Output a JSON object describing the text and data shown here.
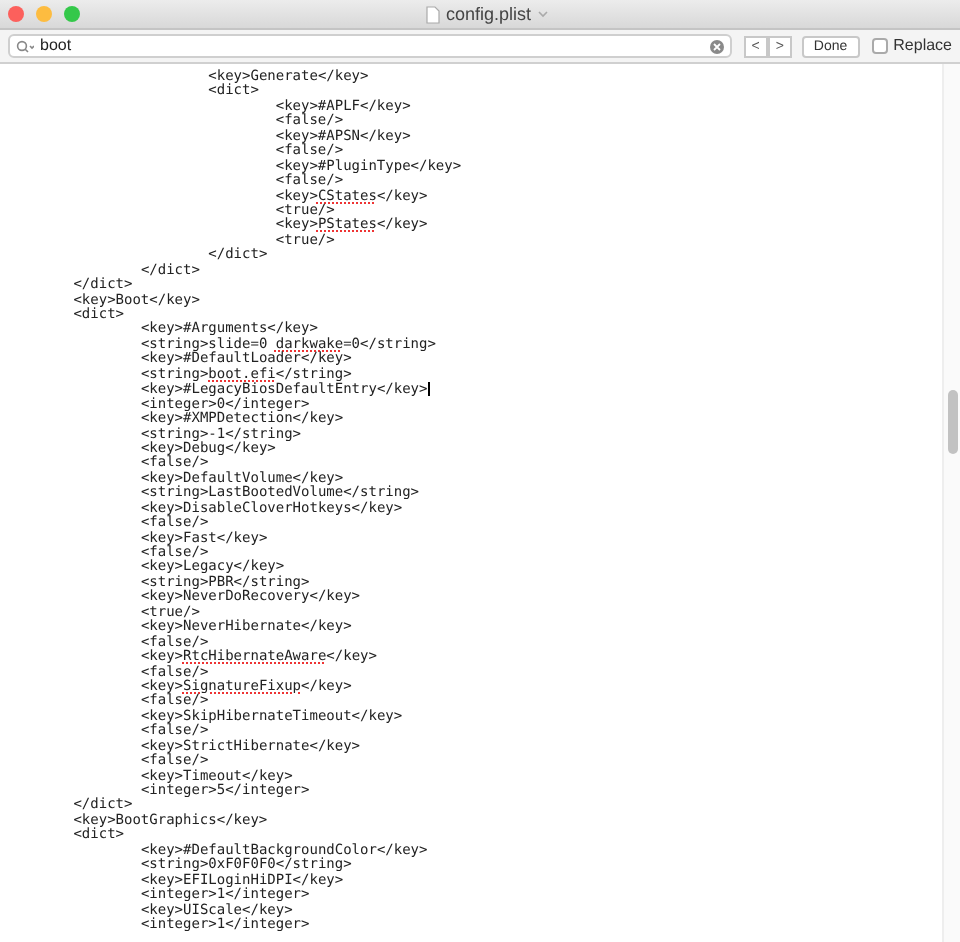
{
  "window": {
    "title": "config.plist"
  },
  "find_bar": {
    "search": {
      "value": "boot"
    },
    "buttons": [
      "<",
      ">"
    ],
    "done": "Done",
    "replace": {
      "label": "Replace",
      "checked": false
    }
  },
  "editor": {
    "lines": [
      {
        "segments": [
          {
            "text": "\t\t\t<key>Generate</key>"
          }
        ]
      },
      {
        "segments": [
          {
            "text": "\t\t\t<dict>"
          }
        ]
      },
      {
        "segments": [
          {
            "text": "\t\t\t\t<key>#APLF</key>"
          }
        ]
      },
      {
        "segments": [
          {
            "text": "\t\t\t\t<false/>"
          }
        ]
      },
      {
        "segments": [
          {
            "text": "\t\t\t\t<key>#APSN</key>"
          }
        ]
      },
      {
        "segments": [
          {
            "text": "\t\t\t\t<false/>"
          }
        ]
      },
      {
        "segments": [
          {
            "text": "\t\t\t\t<key>#PluginType</key>"
          }
        ]
      },
      {
        "segments": [
          {
            "text": "\t\t\t\t<false/>"
          }
        ]
      },
      {
        "segments": [
          {
            "text": "\t\t\t\t<key>"
          },
          {
            "text": "CStates",
            "misspelled": true
          },
          {
            "text": "</key>"
          }
        ]
      },
      {
        "segments": [
          {
            "text": "\t\t\t\t<true/>"
          }
        ]
      },
      {
        "segments": [
          {
            "text": "\t\t\t\t<key>"
          },
          {
            "text": "PStates",
            "misspelled": true
          },
          {
            "text": "</key>"
          }
        ]
      },
      {
        "segments": [
          {
            "text": "\t\t\t\t<true/>"
          }
        ]
      },
      {
        "segments": [
          {
            "text": "\t\t\t</dict>"
          }
        ]
      },
      {
        "segments": [
          {
            "text": "\t\t</dict>"
          }
        ]
      },
      {
        "segments": [
          {
            "text": "\t</dict>"
          }
        ]
      },
      {
        "segments": [
          {
            "text": "\t<key>Boot</key>"
          }
        ]
      },
      {
        "segments": [
          {
            "text": "\t<dict>"
          }
        ]
      },
      {
        "segments": [
          {
            "text": "\t\t<key>#Arguments</key>"
          }
        ]
      },
      {
        "segments": [
          {
            "text": "\t\t<string>slide=0 "
          },
          {
            "text": "darkwake",
            "misspelled": true
          },
          {
            "text": "=0</string>"
          }
        ]
      },
      {
        "segments": [
          {
            "text": "\t\t<key>#DefaultLoader</key>"
          }
        ]
      },
      {
        "segments": [
          {
            "text": "\t\t<string>"
          },
          {
            "text": "boot.efi",
            "misspelled": true
          },
          {
            "text": "</string>"
          }
        ]
      },
      {
        "segments": [
          {
            "text": "\t\t<key>#LegacyBiosDefaultEntry</key>"
          }
        ],
        "cursor": true
      },
      {
        "segments": [
          {
            "text": "\t\t<integer>0</integer>"
          }
        ]
      },
      {
        "segments": [
          {
            "text": "\t\t<key>#XMPDetection</key>"
          }
        ]
      },
      {
        "segments": [
          {
            "text": "\t\t<string>-1</string>"
          }
        ]
      },
      {
        "segments": [
          {
            "text": "\t\t<key>Debug</key>"
          }
        ]
      },
      {
        "segments": [
          {
            "text": "\t\t<false/>"
          }
        ]
      },
      {
        "segments": [
          {
            "text": "\t\t<key>DefaultVolume</key>"
          }
        ]
      },
      {
        "segments": [
          {
            "text": "\t\t<string>LastBootedVolume</string>"
          }
        ]
      },
      {
        "segments": [
          {
            "text": "\t\t<key>DisableCloverHotkeys</key>"
          }
        ]
      },
      {
        "segments": [
          {
            "text": "\t\t<false/>"
          }
        ]
      },
      {
        "segments": [
          {
            "text": "\t\t<key>Fast</key>"
          }
        ]
      },
      {
        "segments": [
          {
            "text": "\t\t<false/>"
          }
        ]
      },
      {
        "segments": [
          {
            "text": "\t\t<key>Legacy</key>"
          }
        ]
      },
      {
        "segments": [
          {
            "text": "\t\t<string>PBR</string>"
          }
        ]
      },
      {
        "segments": [
          {
            "text": "\t\t<key>NeverDoRecovery</key>"
          }
        ]
      },
      {
        "segments": [
          {
            "text": "\t\t<true/>"
          }
        ]
      },
      {
        "segments": [
          {
            "text": "\t\t<key>NeverHibernate</key>"
          }
        ]
      },
      {
        "segments": [
          {
            "text": "\t\t<false/>"
          }
        ]
      },
      {
        "segments": [
          {
            "text": "\t\t<key>"
          },
          {
            "text": "RtcHibernateAware",
            "misspelled": true
          },
          {
            "text": "</key>"
          }
        ]
      },
      {
        "segments": [
          {
            "text": "\t\t<false/>"
          }
        ]
      },
      {
        "segments": [
          {
            "text": "\t\t<key>"
          },
          {
            "text": "SignatureFixup",
            "misspelled": true
          },
          {
            "text": "</key>"
          }
        ]
      },
      {
        "segments": [
          {
            "text": "\t\t<false/>"
          }
        ]
      },
      {
        "segments": [
          {
            "text": "\t\t<key>SkipHibernateTimeout</key>"
          }
        ]
      },
      {
        "segments": [
          {
            "text": "\t\t<false/>"
          }
        ]
      },
      {
        "segments": [
          {
            "text": "\t\t<key>StrictHibernate</key>"
          }
        ]
      },
      {
        "segments": [
          {
            "text": "\t\t<false/>"
          }
        ]
      },
      {
        "segments": [
          {
            "text": "\t\t<key>Timeout</key>"
          }
        ]
      },
      {
        "segments": [
          {
            "text": "\t\t<integer>5</integer>"
          }
        ]
      },
      {
        "segments": [
          {
            "text": "\t</dict>"
          }
        ]
      },
      {
        "segments": [
          {
            "text": "\t<key>BootGraphics</key>"
          }
        ]
      },
      {
        "segments": [
          {
            "text": "\t<dict>"
          }
        ]
      },
      {
        "segments": [
          {
            "text": "\t\t<key>#DefaultBackgroundColor</key>"
          }
        ]
      },
      {
        "segments": [
          {
            "text": "\t\t<string>0xF0F0F0</string>"
          }
        ]
      },
      {
        "segments": [
          {
            "text": "\t\t<key>EFILoginHiDPI</key>"
          }
        ]
      },
      {
        "segments": [
          {
            "text": "\t\t<integer>1</integer>"
          }
        ]
      },
      {
        "segments": [
          {
            "text": "\t\t<key>UIScale</key>"
          }
        ]
      },
      {
        "segments": [
          {
            "text": "\t\t<integer>1</integer>"
          }
        ]
      }
    ]
  }
}
